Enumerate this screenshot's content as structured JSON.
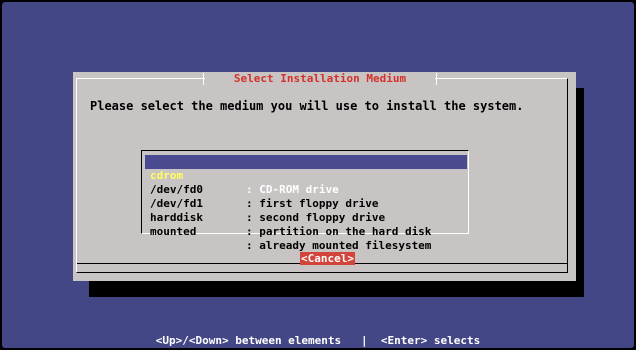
{
  "dialog": {
    "title": "Select Installation Medium",
    "prompt": "Please select the medium you will use to install the system.",
    "cancel_label": "<Cancel>"
  },
  "menu": {
    "items": [
      {
        "key": "cdrom",
        "desc": ": CD-ROM drive",
        "selected": true
      },
      {
        "key": "/dev/fd0",
        "desc": ": first floppy drive",
        "selected": false
      },
      {
        "key": "/dev/fd1",
        "desc": ": second floppy drive",
        "selected": false
      },
      {
        "key": "harddisk",
        "desc": ": partition on the hard disk",
        "selected": false
      },
      {
        "key": "mounted",
        "desc": ": already mounted filesystem",
        "selected": false
      }
    ]
  },
  "footer": {
    "hint": "<Up>/<Down> between elements   |  <Enter> selects"
  },
  "colors": {
    "background": "#444785",
    "dialog": "#c8c4c3",
    "title": "#d4312a",
    "selection": "#4a4a90",
    "selection_key": "#ffff5a",
    "button": "#d3453a"
  }
}
